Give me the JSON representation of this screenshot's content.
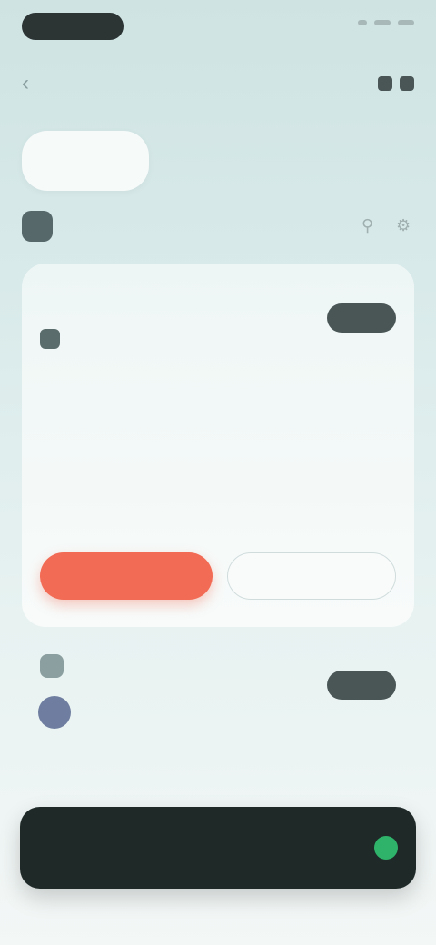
{
  "header": {
    "title": "",
    "icons": [
      "back-icon",
      "share-icon",
      "more-icon"
    ]
  },
  "tabs": [
    {
      "label": ""
    },
    {
      "label": ""
    },
    {
      "label": ""
    }
  ],
  "account": {
    "label": ""
  },
  "card": {
    "title": "",
    "subtitle": "",
    "badge": "",
    "details": [
      {
        "label": "",
        "value": ""
      },
      {
        "label": "",
        "value": ""
      },
      {
        "label": "",
        "value": ""
      },
      {
        "label": "",
        "value": ""
      }
    ],
    "primary_action": "",
    "secondary_action": ""
  },
  "card2": {
    "label": "",
    "badge": "",
    "detail": {
      "label": "",
      "value": ""
    }
  },
  "bottom_bar": {
    "text": ""
  },
  "colors": {
    "accent": "#f26b54",
    "dark": "#1f2a28",
    "success": "#2fb36b"
  }
}
